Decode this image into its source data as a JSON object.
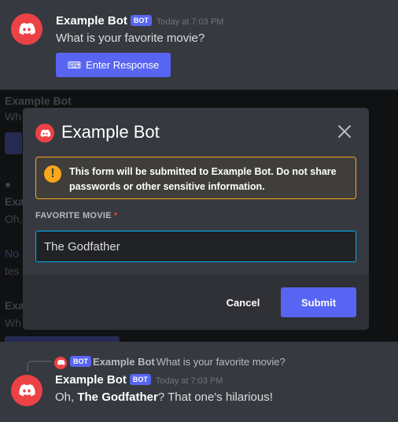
{
  "top_message": {
    "username": "Example Bot",
    "bot_tag": "BOT",
    "timestamp": "Today at 7:03 PM",
    "text": "What is your favorite movie?",
    "button_label": "Enter Response",
    "button_icon": "keyboard-icon"
  },
  "modal": {
    "title": "Example Bot",
    "warning_pre": "This form will be submitted to ",
    "warning_bot": "Example Bot",
    "warning_post": ". Do not share passwords or other sensitive information.",
    "field_label": "FAVORITE MOVIE",
    "required_marker": "*",
    "field_value": "The Godfather",
    "cancel_label": "Cancel",
    "submit_label": "Submit"
  },
  "bottom_message": {
    "reply_bot_tag": "BOT",
    "reply_username": "Example Bot",
    "reply_text": "What is your favorite movie?",
    "username": "Example Bot",
    "bot_tag": "BOT",
    "timestamp": "Today at 7:03 PM",
    "text_pre": "Oh, ",
    "text_bold": "The Godfather",
    "text_post": "? That one's hilarious!"
  },
  "colors": {
    "blurple": "#5865f2",
    "avatar_red": "#ed4245",
    "warning": "#faa61a",
    "focus": "#00aff4"
  }
}
